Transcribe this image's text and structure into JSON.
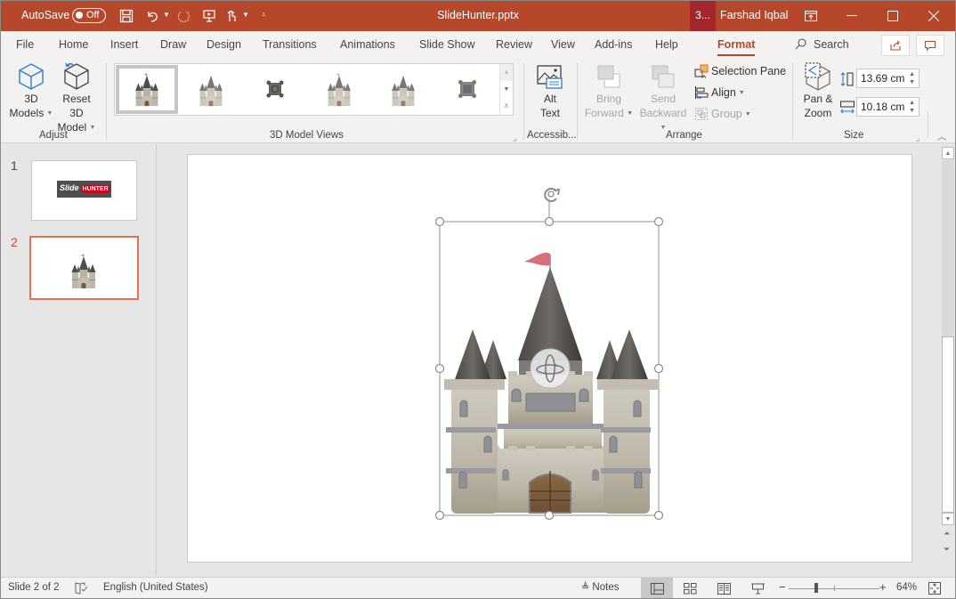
{
  "titlebar": {
    "autosave_label": "AutoSave",
    "autosave_state": "Off",
    "document_title": "SlideHunter.pptx",
    "badge": "3...",
    "user_name": "Farshad Iqbal",
    "accent_color": "#b7472a"
  },
  "tabs": [
    {
      "label": "File"
    },
    {
      "label": "Home"
    },
    {
      "label": "Insert"
    },
    {
      "label": "Draw"
    },
    {
      "label": "Design"
    },
    {
      "label": "Transitions"
    },
    {
      "label": "Animations"
    },
    {
      "label": "Slide Show"
    },
    {
      "label": "Review"
    },
    {
      "label": "View"
    },
    {
      "label": "Add-ins"
    },
    {
      "label": "Help"
    },
    {
      "label": "Format",
      "active": true
    }
  ],
  "search": {
    "label": "Search"
  },
  "ribbon": {
    "adjust": {
      "label": "Adjust",
      "models_line1": "3D",
      "models_line2": "Models",
      "reset_line1": "Reset 3D",
      "reset_line2": "Model"
    },
    "views": {
      "label": "3D Model Views",
      "items": [
        {
          "name": "Front",
          "selected": true
        },
        {
          "name": "Front faded"
        },
        {
          "name": "Top"
        },
        {
          "name": "Front flag"
        },
        {
          "name": "Front 2"
        },
        {
          "name": "Below"
        }
      ]
    },
    "accessibility": {
      "label": "Accessib...",
      "alt_line1": "Alt",
      "alt_line2": "Text"
    },
    "arrange": {
      "label": "Arrange",
      "bring_line1": "Bring",
      "bring_line2": "Forward",
      "send_line1": "Send",
      "send_line2": "Backward",
      "selection_pane": "Selection Pane",
      "align": "Align",
      "group": "Group"
    },
    "size": {
      "label": "Size",
      "pan_line1": "Pan &",
      "pan_line2": "Zoom",
      "height_value": "13.69 cm",
      "width_value": "10.18 cm"
    }
  },
  "slides": [
    {
      "number": "1",
      "logo_text": "Slide",
      "logo_badge": "HUNTER"
    },
    {
      "number": "2",
      "active": true
    }
  ],
  "statusbar": {
    "slide_info": "Slide 2 of 2",
    "language": "English (United States)",
    "notes": "Notes",
    "zoom_percent": "64%",
    "zoom_level": 64
  }
}
